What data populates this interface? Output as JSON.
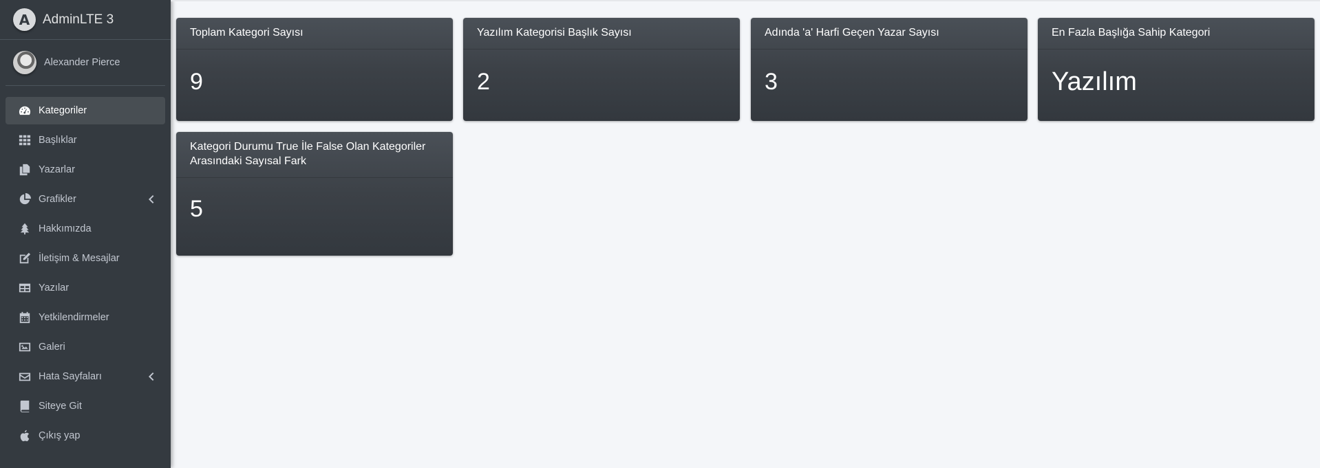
{
  "brand": {
    "title": "AdminLTE 3",
    "logo_letter": "A"
  },
  "user": {
    "name": "Alexander Pierce"
  },
  "nav": [
    {
      "label": "Kategoriler",
      "icon": "tachometer-icon",
      "active": true
    },
    {
      "label": "Başlıklar",
      "icon": "grid-icon"
    },
    {
      "label": "Yazarlar",
      "icon": "copy-icon"
    },
    {
      "label": "Grafikler",
      "icon": "pie-chart-icon",
      "has_chevron": true
    },
    {
      "label": "Hakkımızda",
      "icon": "tree-icon"
    },
    {
      "label": "İletişim & Mesajlar",
      "icon": "edit-icon"
    },
    {
      "label": "Yazılar",
      "icon": "table-icon"
    },
    {
      "label": "Yetkilendirmeler",
      "icon": "calendar-icon"
    },
    {
      "label": "Galeri",
      "icon": "image-icon"
    },
    {
      "label": "Hata Sayfaları",
      "icon": "envelope-icon",
      "has_chevron": true
    },
    {
      "label": "Siteye Git",
      "icon": "book-icon"
    },
    {
      "label": "Çıkış yap",
      "icon": "apple-icon"
    }
  ],
  "cards": [
    {
      "title": "Toplam Kategori Sayısı",
      "value": "9"
    },
    {
      "title": "Yazılım Kategorisi Başlık Sayısı",
      "value": "2"
    },
    {
      "title": "Adında 'a' Harfi Geçen Yazar Sayısı",
      "value": "3"
    },
    {
      "title": "En Fazla Başlığa Sahip Kategori",
      "value": "Yazılım"
    },
    {
      "title_line1": "Kategori Durumu True İle False Olan Kategoriler",
      "title_line2": "Arasındaki Sayısal Fark",
      "value": "5"
    }
  ],
  "colors": {
    "sidebar": "#343a40",
    "content_bg": "#f4f6f9",
    "card_top": "#4a5057",
    "card_bottom": "#33383e"
  }
}
